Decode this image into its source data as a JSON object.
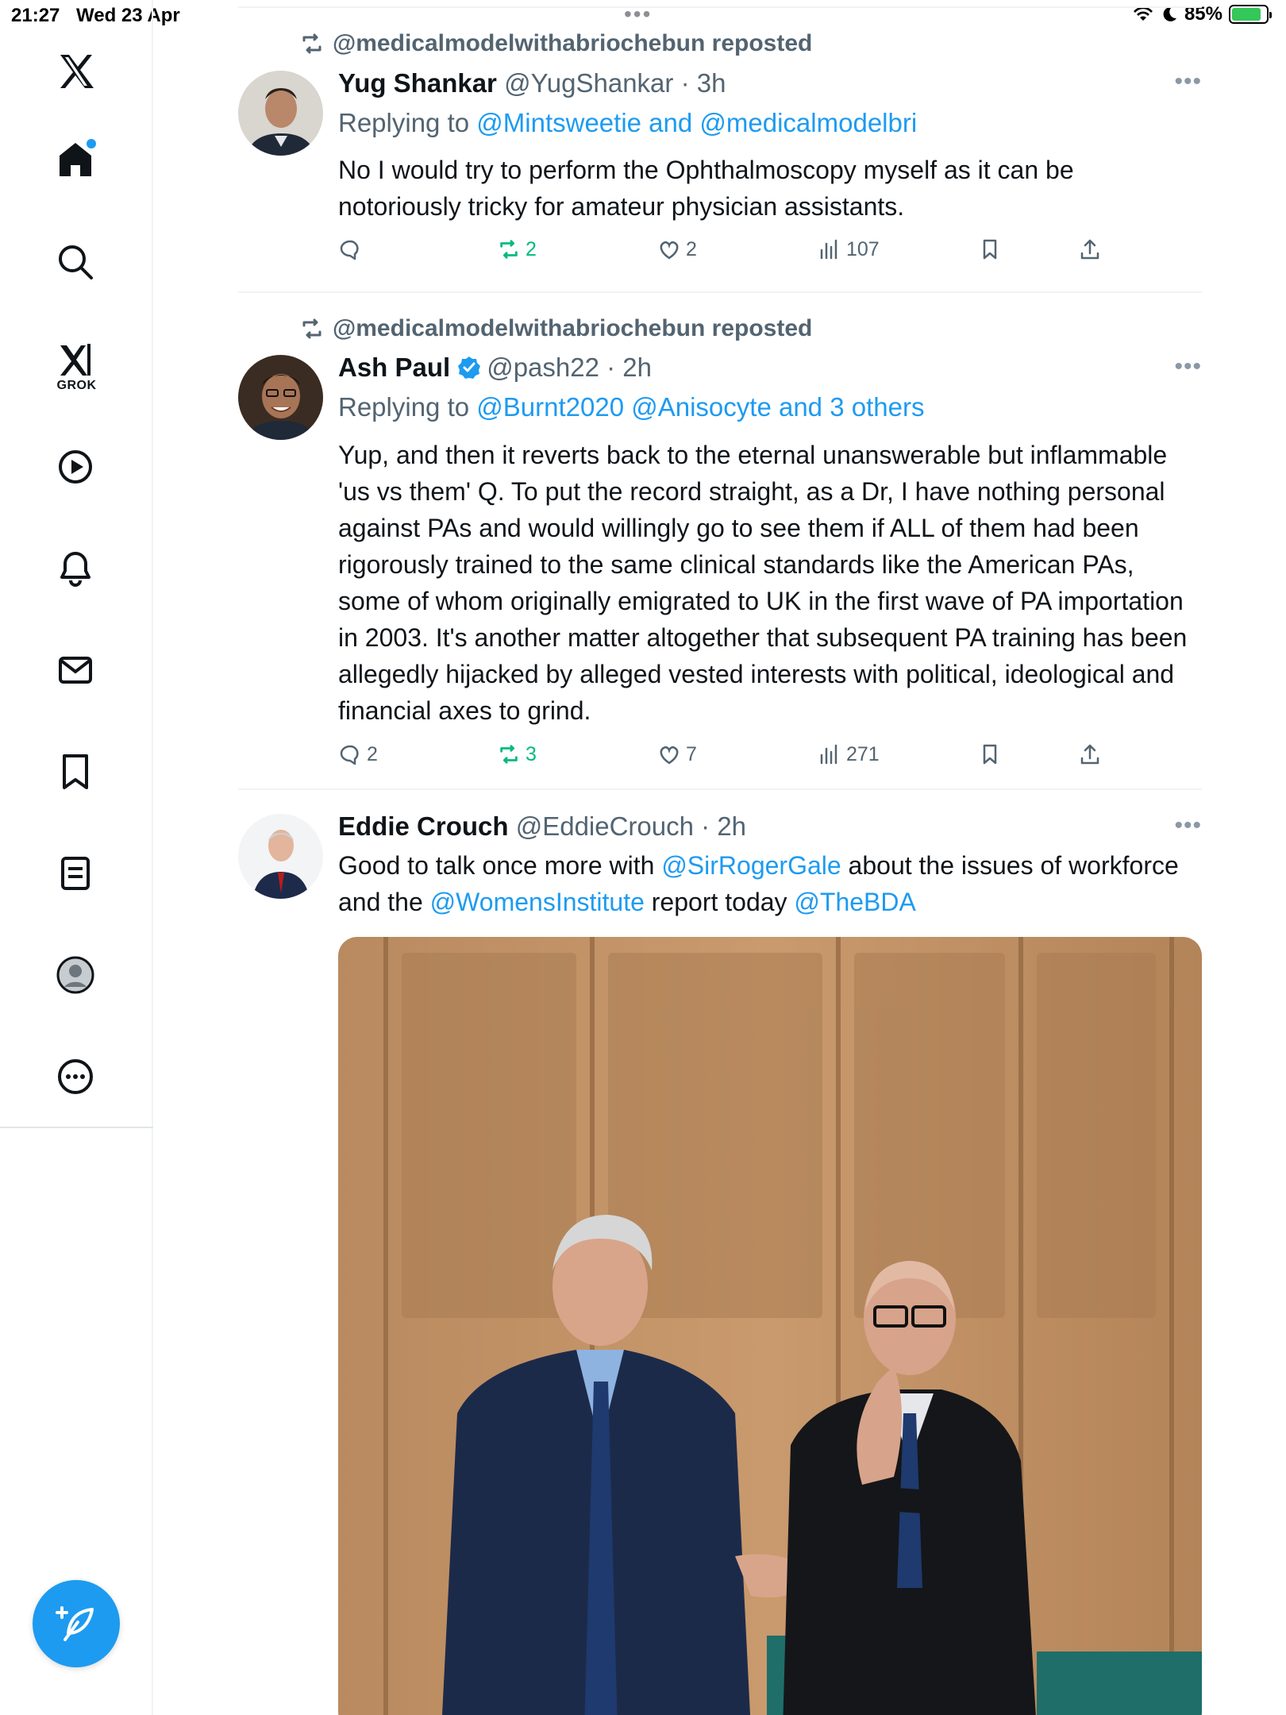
{
  "status_bar": {
    "time": "21:27",
    "date": "Wed 23 Apr",
    "battery": "85%"
  },
  "sidebar": {
    "grok_label": "GROK",
    "items": [
      "x-logo",
      "home",
      "search",
      "grok",
      "video",
      "notifications",
      "messages",
      "bookmarks",
      "lists",
      "profile",
      "more"
    ]
  },
  "tweets": [
    {
      "repost_by": "@medicalmodelwithabriochebun reposted",
      "name": "Yug Shankar",
      "handle": "@YugShankar",
      "time": "· 3h",
      "replying_prefix": "Replying to",
      "replying_to": "@Mintsweetie and @medicalmodelbri",
      "text": "No I would try to perform the Ophthalmoscopy myself as it can be notoriously tricky for amateur physician assistants.",
      "replies": "",
      "reposts": "2",
      "likes": "2",
      "views": "107"
    },
    {
      "repost_by": "@medicalmodelwithabriochebun reposted",
      "name": "Ash Paul",
      "handle": "@pash22",
      "time": "· 2h",
      "replying_prefix": "Replying to",
      "replying_to": "@Burnt2020 @Anisocyte and 3 others",
      "text": "Yup, and then it reverts back to the eternal unanswerable but inflammable 'us vs them' Q. To put the record straight, as a Dr, I have nothing personal against PAs and would willingly go to see them if ALL of them had been rigorously trained to the same clinical standards like the American PAs, some of whom originally emigrated to UK in the first wave of PA importation in 2003. It's another matter altogether that subsequent PA training has been allegedly hijacked by alleged vested interests with political, ideological and financial axes to grind.",
      "replies": "2",
      "reposts": "3",
      "likes": "7",
      "views": "271"
    },
    {
      "name": "Eddie Crouch",
      "handle": "@EddieCrouch",
      "time": "· 2h",
      "text_1": "Good to talk once more with ",
      "mention_1": "@SirRogerGale",
      "text_2": " about the issues of workforce and the ",
      "mention_2": "@WomensInstitute",
      "text_3": " report today ",
      "mention_3": "@TheBDA"
    }
  ],
  "colors": {
    "accent": "#1d9bf0",
    "repost_green": "#00ba7c",
    "muted": "#536471"
  }
}
